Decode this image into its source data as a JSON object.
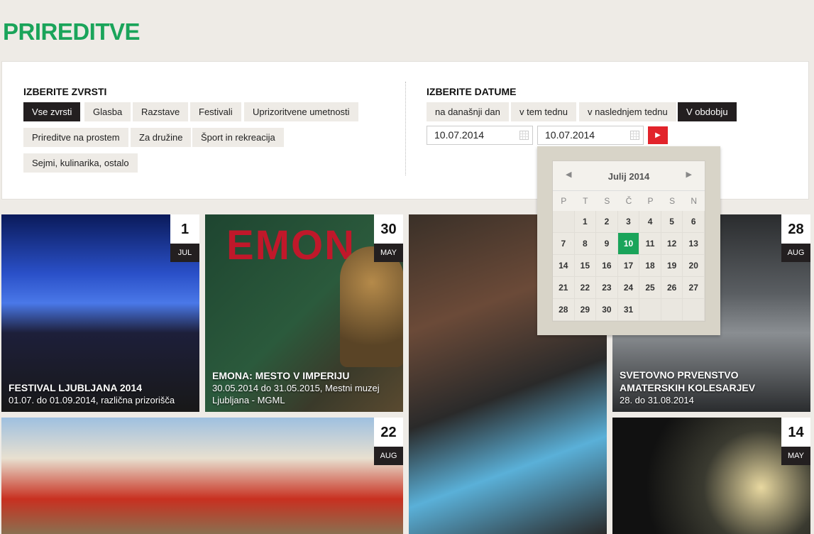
{
  "page": {
    "title": "PRIREDITVE"
  },
  "genres": {
    "label": "IZBERITE ZVRSTI",
    "items": [
      "Vse zvrsti",
      "Glasba",
      "Razstave",
      "Festivali",
      "Uprizoritvene umetnosti",
      "Prireditve na prostem",
      "Za družine",
      "Šport in rekreacija",
      "Sejmi, kulinarika, ostalo"
    ],
    "active": "Vse zvrsti"
  },
  "dates": {
    "label": "IZBERITE DATUME",
    "items": [
      "na današnji dan",
      "v tem tednu",
      "v naslednjem tednu",
      "V obdobju"
    ],
    "active": "V obdobju",
    "from": "10.07.2014",
    "to": "10.07.2014",
    "go_icon": "play-triangle-icon"
  },
  "calendar": {
    "month": "Julij 2014",
    "weekdays": [
      "P",
      "T",
      "S",
      "Č",
      "P",
      "S",
      "N"
    ],
    "selected": 10,
    "first_weekday_offset": 1,
    "days_in_month": 31
  },
  "events": [
    {
      "day": "1",
      "month": "JUL",
      "title": "FESTIVAL LJUBLJANA 2014",
      "sub": "01.07. do 01.09.2014, različna prizorišča"
    },
    {
      "day": "30",
      "month": "MAY",
      "title": "EMONA: MESTO V IMPERIJU",
      "sub": "30.05.2014 do 31.05.2015, Mestni muzej Ljubljana - MGML"
    },
    {
      "day": "28",
      "month": "AUG",
      "title": "SVETOVNO PRVENSTVO AMATERSKIH KOLESARJEV",
      "sub": "28. do 31.08.2014"
    },
    {
      "day": "22",
      "month": "AUG",
      "title": "",
      "sub": ""
    },
    {
      "day": "14",
      "month": "MAY",
      "title": "",
      "sub": ""
    }
  ],
  "colors": {
    "accent": "#1aa45a",
    "dark": "#231f20",
    "red": "#e2232a"
  }
}
